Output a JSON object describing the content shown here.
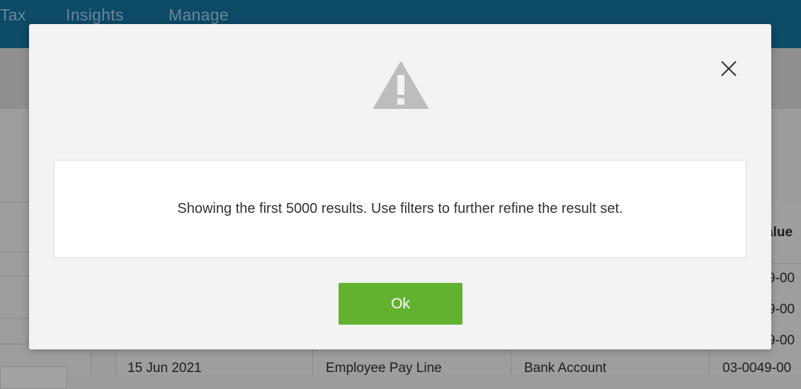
{
  "nav": {
    "tabs": [
      "Tax",
      "Insights",
      "Manage"
    ]
  },
  "table": {
    "header_value": "alue",
    "partial_values": [
      "9-00",
      "9-00",
      "9-00"
    ],
    "row": {
      "date": "15 Jun 2021",
      "type": "Employee Pay Line",
      "account": "Bank Account",
      "value": "03-0049-00"
    }
  },
  "modal": {
    "icon": "warning-triangle-icon",
    "close_icon": "close-icon",
    "message": "Showing the first 5000 results. Use filters to further refine the result set.",
    "ok_label": "Ok"
  },
  "colors": {
    "accent": "#62b22f",
    "nav_bg": "#0c4a66",
    "icon_gray": "#bdbdbd"
  }
}
